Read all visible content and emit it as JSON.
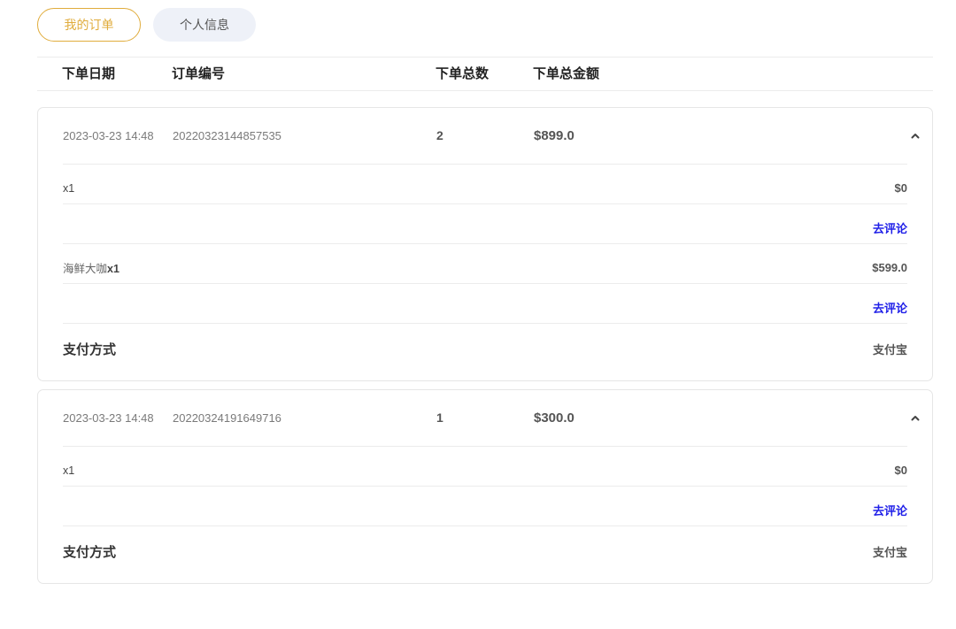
{
  "colors": {
    "accent": "#e0ac3c",
    "tab_inactive_bg": "#eef1f8",
    "link": "#1f1fe8"
  },
  "tabs": [
    {
      "label": "我的订单",
      "active": true
    },
    {
      "label": "个人信息",
      "active": false
    }
  ],
  "table_header": {
    "date": "下单日期",
    "order_no": "订单编号",
    "total_qty": "下单总数",
    "total_amount": "下单总金额"
  },
  "icons": {
    "toggle": "chevron-up-icon"
  },
  "orders": [
    {
      "date": "2023-03-23 14:48",
      "order_no": "20220323144857535",
      "qty": "2",
      "amount": "$899.0",
      "expanded": true,
      "items": [
        {
          "qty": "x1",
          "price": "$0",
          "review_label": "去评论"
        },
        {
          "name": "海鲜大咖",
          "qty": "x1",
          "price": "$599.0",
          "review_label": "去评论"
        }
      ],
      "payment_label": "支付方式",
      "payment_value": "支付宝"
    },
    {
      "date": "2023-03-23 14:48",
      "order_no": "20220324191649716",
      "qty": "1",
      "amount": "$300.0",
      "expanded": true,
      "items": [
        {
          "qty": "x1",
          "price": "$0",
          "review_label": "去评论"
        }
      ],
      "payment_label": "支付方式",
      "payment_value": "支付宝"
    }
  ]
}
